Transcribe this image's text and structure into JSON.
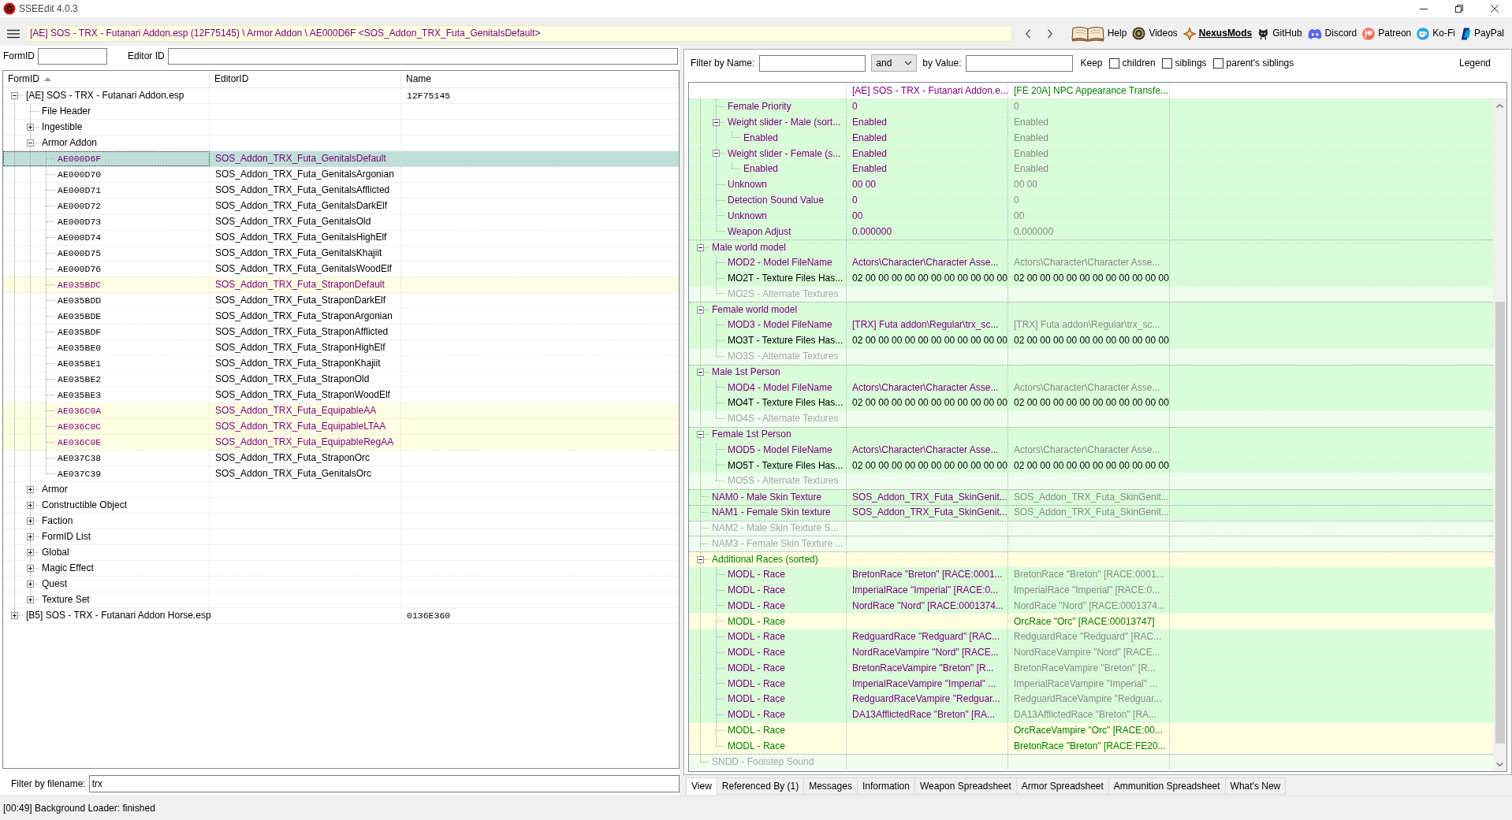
{
  "window": {
    "title": "SSEEdit 4.0.3"
  },
  "toolbar": {
    "breadcrumb": "[AE] SOS - TRX - Futanari Addon.esp (12F75145) \\ Armor Addon \\ AE000D6F <SOS_Addon_TRX_Futa_GenitalsDefault>",
    "links": [
      {
        "kind": "book",
        "label": "Help",
        "emphasized": false
      },
      {
        "kind": "video",
        "label": "Videos",
        "emphasized": false
      },
      {
        "kind": "nexus",
        "label": "NexusMods",
        "emphasized": true
      },
      {
        "kind": "github",
        "label": "GitHub",
        "emphasized": false
      },
      {
        "kind": "discord",
        "label": "Discord",
        "emphasized": false
      },
      {
        "kind": "patreon",
        "label": "Patreon",
        "emphasized": false
      },
      {
        "kind": "kofi",
        "label": "Ko-Fi",
        "emphasized": false
      },
      {
        "kind": "paypal",
        "label": "PayPal",
        "emphasized": false
      }
    ]
  },
  "left_pane": {
    "formid_label": "FormID",
    "editorid_label": "Editor ID",
    "tree": {
      "columns": [
        {
          "label": "FormID",
          "sorted": true
        },
        {
          "label": "EditorID",
          "sorted": false
        },
        {
          "label": "Name",
          "sorted": false
        }
      ],
      "nodes": [
        {
          "label": "[AE] SOS - TRX - Futanari Addon.esp",
          "name": "12F75145",
          "expanded": true,
          "selected": false,
          "children": [
            {
              "label": "File Header",
              "selected": false
            },
            {
              "label": "Ingestible",
              "expanded": false,
              "selected": false
            },
            {
              "label": "Armor Addon",
              "expanded": true,
              "selected": false,
              "children": [
                {
                  "form_id": "AE000D6F",
                  "editor_id": "SOS_Addon_TRX_Futa_GenitalsDefault",
                  "highlighted": true,
                  "selected": true
                },
                {
                  "form_id": "AE000D70",
                  "editor_id": "SOS_Addon_TRX_Futa_GenitalsArgonian",
                  "highlighted": false,
                  "selected": false
                },
                {
                  "form_id": "AE000D71",
                  "editor_id": "SOS_Addon_TRX_Futa_GenitalsAfflicted",
                  "highlighted": false,
                  "selected": false
                },
                {
                  "form_id": "AE000D72",
                  "editor_id": "SOS_Addon_TRX_Futa_GenitalsDarkElf",
                  "highlighted": false,
                  "selected": false
                },
                {
                  "form_id": "AE000D73",
                  "editor_id": "SOS_Addon_TRX_Futa_GenitalsOld",
                  "highlighted": false,
                  "selected": false
                },
                {
                  "form_id": "AE000D74",
                  "editor_id": "SOS_Addon_TRX_Futa_GenitalsHighElf",
                  "highlighted": false,
                  "selected": false
                },
                {
                  "form_id": "AE000D75",
                  "editor_id": "SOS_Addon_TRX_Futa_GenitalsKhajiit",
                  "highlighted": false,
                  "selected": false
                },
                {
                  "form_id": "AE000D76",
                  "editor_id": "SOS_Addon_TRX_Futa_GenitalsWoodElf",
                  "highlighted": false,
                  "selected": false
                },
                {
                  "form_id": "AE035BDC",
                  "editor_id": "SOS_Addon_TRX_Futa_StraponDefault",
                  "highlighted": true,
                  "selected": false
                },
                {
                  "form_id": "AE035BDD",
                  "editor_id": "SOS_Addon_TRX_Futa_StraponDarkElf",
                  "highlighted": false,
                  "selected": false
                },
                {
                  "form_id": "AE035BDE",
                  "editor_id": "SOS_Addon_TRX_Futa_StraponArgonian",
                  "highlighted": false,
                  "selected": false
                },
                {
                  "form_id": "AE035BDF",
                  "editor_id": "SOS_Addon_TRX_Futa_StraponAfflicted",
                  "highlighted": false,
                  "selected": false
                },
                {
                  "form_id": "AE035BE0",
                  "editor_id": "SOS_Addon_TRX_Futa_StraponHighElf",
                  "highlighted": false,
                  "selected": false
                },
                {
                  "form_id": "AE035BE1",
                  "editor_id": "SOS_Addon_TRX_Futa_StraponKhajiit",
                  "highlighted": false,
                  "selected": false
                },
                {
                  "form_id": "AE035BE2",
                  "editor_id": "SOS_Addon_TRX_Futa_StraponOld",
                  "highlighted": false,
                  "selected": false
                },
                {
                  "form_id": "AE035BE3",
                  "editor_id": "SOS_Addon_TRX_Futa_StraponWoodElf",
                  "highlighted": false,
                  "selected": false
                },
                {
                  "form_id": "AE036C0A",
                  "editor_id": "SOS_Addon_TRX_Futa_EquipableAA",
                  "highlighted": true,
                  "selected": false
                },
                {
                  "form_id": "AE036C0C",
                  "editor_id": "SOS_Addon_TRX_Futa_EquipableLTAA",
                  "highlighted": true,
                  "selected": false
                },
                {
                  "form_id": "AE036C0E",
                  "editor_id": "SOS_Addon_TRX_Futa_EquipableRegAA",
                  "highlighted": true,
                  "selected": false
                },
                {
                  "form_id": "AE037C38",
                  "editor_id": "SOS_Addon_TRX_Futa_StraponOrc",
                  "highlighted": false,
                  "selected": false
                },
                {
                  "form_id": "AE037C39",
                  "editor_id": "SOS_Addon_TRX_Futa_GenitalsOrc",
                  "highlighted": false,
                  "selected": false
                }
              ]
            },
            {
              "label": "Armor",
              "expanded": false,
              "selected": false
            },
            {
              "label": "Constructible Object",
              "expanded": false,
              "selected": false
            },
            {
              "label": "Faction",
              "expanded": false,
              "selected": false
            },
            {
              "label": "FormID List",
              "expanded": false,
              "selected": false
            },
            {
              "label": "Global",
              "expanded": false,
              "selected": false
            },
            {
              "label": "Magic Effect",
              "expanded": false,
              "selected": false
            },
            {
              "label": "Quest",
              "expanded": false,
              "selected": false
            },
            {
              "label": "Texture Set",
              "expanded": false,
              "selected": false
            }
          ]
        },
        {
          "label": "[B5] SOS - TRX - Futanari Addon Horse.esp",
          "name": "0136E360",
          "expanded": false,
          "selected": false
        }
      ]
    },
    "filename_filter": {
      "label": "Filter by filename:",
      "value": "trx"
    }
  },
  "record_view": {
    "filter": {
      "name_label": "Filter by Name:",
      "operator": "and",
      "value_label": "by Value:",
      "keep_label": "Keep",
      "options": [
        {
          "label": "children",
          "checked": false
        },
        {
          "label": "siblings",
          "checked": false
        },
        {
          "label": "parent's siblings",
          "checked": false
        }
      ],
      "legend": "Legend"
    },
    "columns": [
      {
        "label": "[AE] SOS - TRX - Futanari Addon.e...",
        "color": "#800080"
      },
      {
        "label": "[FE 20A] NPC Appearance Transfe...",
        "color": "#008000"
      }
    ],
    "rows": [
      {
        "children": [
          {
            "label": "Female Priority",
            "kind": "override",
            "col_1": "0",
            "col_2": "0"
          },
          {
            "label": "Weight slider - Male (sort...",
            "kind": "override",
            "col_1": "Enabled",
            "col_2": "Enabled",
            "expanded": true,
            "children": [
              {
                "label": "Enabled",
                "kind": "override",
                "col_1": "Enabled",
                "col_2": "Enabled"
              }
            ]
          },
          {
            "label": "Weight slider - Female (s...",
            "kind": "override",
            "col_1": "Enabled",
            "col_2": "Enabled",
            "expanded": true,
            "children": [
              {
                "label": "Enabled",
                "kind": "override",
                "col_1": "Enabled",
                "col_2": "Enabled"
              }
            ]
          },
          {
            "label": "Unknown",
            "kind": "override",
            "col_1": "00 00",
            "col_2": "00 00"
          },
          {
            "label": "Detection Sound Value",
            "kind": "override",
            "col_1": "0",
            "col_2": "0"
          },
          {
            "label": "Unknown",
            "kind": "override",
            "col_1": "00",
            "col_2": "00"
          },
          {
            "label": "Weapon Adjust",
            "kind": "override",
            "col_1": "0.000000",
            "col_2": "0.000000"
          }
        ]
      },
      {
        "label": "Male world model",
        "kind": "override",
        "expanded": true,
        "children": [
          {
            "label": "MOD2 - Model FileName",
            "kind": "override",
            "col_1": "Actors\\Character\\Character Asse...",
            "col_2": "Actors\\Character\\Character Asse..."
          },
          {
            "label": "MO2T - Texture Files Has...",
            "kind": "identical",
            "col_1": "02 00 00 00 00 00 00 00 00 00 00 00",
            "col_2": "02 00 00 00 00 00 00 00 00 00 00 00"
          },
          {
            "label": "MO2S - Alternate Textures",
            "kind": "empty"
          }
        ]
      },
      {
        "label": "Female world model",
        "kind": "override",
        "expanded": true,
        "children": [
          {
            "label": "MOD3 - Model FileName",
            "kind": "override",
            "col_1": "[TRX] Futa addon\\Regular\\trx_sc...",
            "col_2": "[TRX] Futa addon\\Regular\\trx_sc..."
          },
          {
            "label": "MO3T - Texture Files Has...",
            "kind": "identical",
            "col_1": "02 00 00 00 00 00 00 00 00 00 00 00",
            "col_2": "02 00 00 00 00 00 00 00 00 00 00 00"
          },
          {
            "label": "MO3S - Alternate Textures",
            "kind": "empty"
          }
        ]
      },
      {
        "label": "Male 1st Person",
        "kind": "override",
        "expanded": true,
        "children": [
          {
            "label": "MOD4 - Model FileName",
            "kind": "override",
            "col_1": "Actors\\Character\\Character Asse...",
            "col_2": "Actors\\Character\\Character Asse..."
          },
          {
            "label": "MO4T - Texture Files Has...",
            "kind": "identical",
            "col_1": "02 00 00 00 00 00 00 00 00 00 00 00",
            "col_2": "02 00 00 00 00 00 00 00 00 00 00 00"
          },
          {
            "label": "MO4S - Alternate Textures",
            "kind": "empty"
          }
        ]
      },
      {
        "label": "Female 1st Person",
        "kind": "override",
        "expanded": true,
        "children": [
          {
            "label": "MOD5 - Model FileName",
            "kind": "override",
            "col_1": "Actors\\Character\\Character Asse...",
            "col_2": "Actors\\Character\\Character Asse..."
          },
          {
            "label": "MO5T - Texture Files Has...",
            "kind": "identical",
            "col_1": "02 00 00 00 00 00 00 00 00 00 00 00",
            "col_2": "02 00 00 00 00 00 00 00 00 00 00 00"
          },
          {
            "label": "MO5S - Alternate Textures",
            "kind": "empty"
          }
        ]
      },
      {
        "label": "NAM0 - Male Skin Texture",
        "kind": "override",
        "col_1": "SOS_Addon_TRX_Futa_SkinGenit...",
        "col_2": "SOS_Addon_TRX_Futa_SkinGenit..."
      },
      {
        "label": "NAM1 - Female Skin texture",
        "kind": "override",
        "col_1": "SOS_Addon_TRX_Futa_SkinGenit...",
        "col_2": "SOS_Addon_TRX_Futa_SkinGenit..."
      },
      {
        "label": "NAM2 - Male Skin Texture S...",
        "kind": "empty"
      },
      {
        "label": "NAM3 - Female Skin Texture ...",
        "kind": "empty"
      },
      {
        "label": "Additional Races (sorted)",
        "kind": "added",
        "expanded": true,
        "children": [
          {
            "label": "MODL - Race",
            "kind": "override",
            "col_1": "BretonRace \"Breton\" [RACE:0001...",
            "col_2": "BretonRace \"Breton\" [RACE:0001..."
          },
          {
            "label": "MODL - Race",
            "kind": "override",
            "col_1": "ImperialRace \"Imperial\" [RACE:0...",
            "col_2": "ImperialRace \"Imperial\" [RACE:0..."
          },
          {
            "label": "MODL - Race",
            "kind": "override",
            "col_1": "NordRace \"Nord\" [RACE:0001374...",
            "col_2": "NordRace \"Nord\" [RACE:0001374..."
          },
          {
            "label": "MODL - Race",
            "kind": "added",
            "col_2": "OrcRace \"Orc\" [RACE:00013747]"
          },
          {
            "label": "MODL - Race",
            "kind": "override",
            "col_1": "RedguardRace \"Redguard\" [RAC...",
            "col_2": "RedguardRace \"Redguard\" [RAC..."
          },
          {
            "label": "MODL - Race",
            "kind": "override",
            "col_1": "NordRaceVampire \"Nord\" [RACE...",
            "col_2": "NordRaceVampire \"Nord\" [RACE..."
          },
          {
            "label": "MODL - Race",
            "kind": "override",
            "col_1": "BretonRaceVampire \"Breton\" [R...",
            "col_2": "BretonRaceVampire \"Breton\" [R..."
          },
          {
            "label": "MODL - Race",
            "kind": "override",
            "col_1": "ImperialRaceVampire \"Imperial\" ...",
            "col_2": "ImperialRaceVampire \"Imperial\" ..."
          },
          {
            "label": "MODL - Race",
            "kind": "override",
            "col_1": "RedguardRaceVampire \"Redguar...",
            "col_2": "RedguardRaceVampire \"Redguar..."
          },
          {
            "label": "MODL - Race",
            "kind": "override",
            "col_1": "DA13AfflictedRace \"Breton\" [RA...",
            "col_2": "DA13AfflictedRace \"Breton\" [RA..."
          },
          {
            "label": "MODL - Race",
            "kind": "added",
            "col_2": "OrcRaceVampire \"Orc\" [RACE:00..."
          },
          {
            "label": "MODL - Race",
            "kind": "added",
            "col_2": "BretonRace \"Breton\" [RACE:FE20..."
          }
        ]
      },
      {
        "label": "SNDD - Footstep Sound",
        "kind": "empty"
      }
    ],
    "tabs": [
      {
        "label": "View",
        "selected": true
      },
      {
        "label": "Referenced By (1)",
        "selected": false
      },
      {
        "label": "Messages",
        "selected": false
      },
      {
        "label": "Information",
        "selected": false
      },
      {
        "label": "Weapon Spreadsheet",
        "selected": false
      },
      {
        "label": "Armor Spreadsheet",
        "selected": false
      },
      {
        "label": "Ammunition Spreadsheet",
        "selected": false
      },
      {
        "label": "What's New",
        "selected": false
      }
    ]
  },
  "status_bar": "[00:49] Background Loader: finished"
}
